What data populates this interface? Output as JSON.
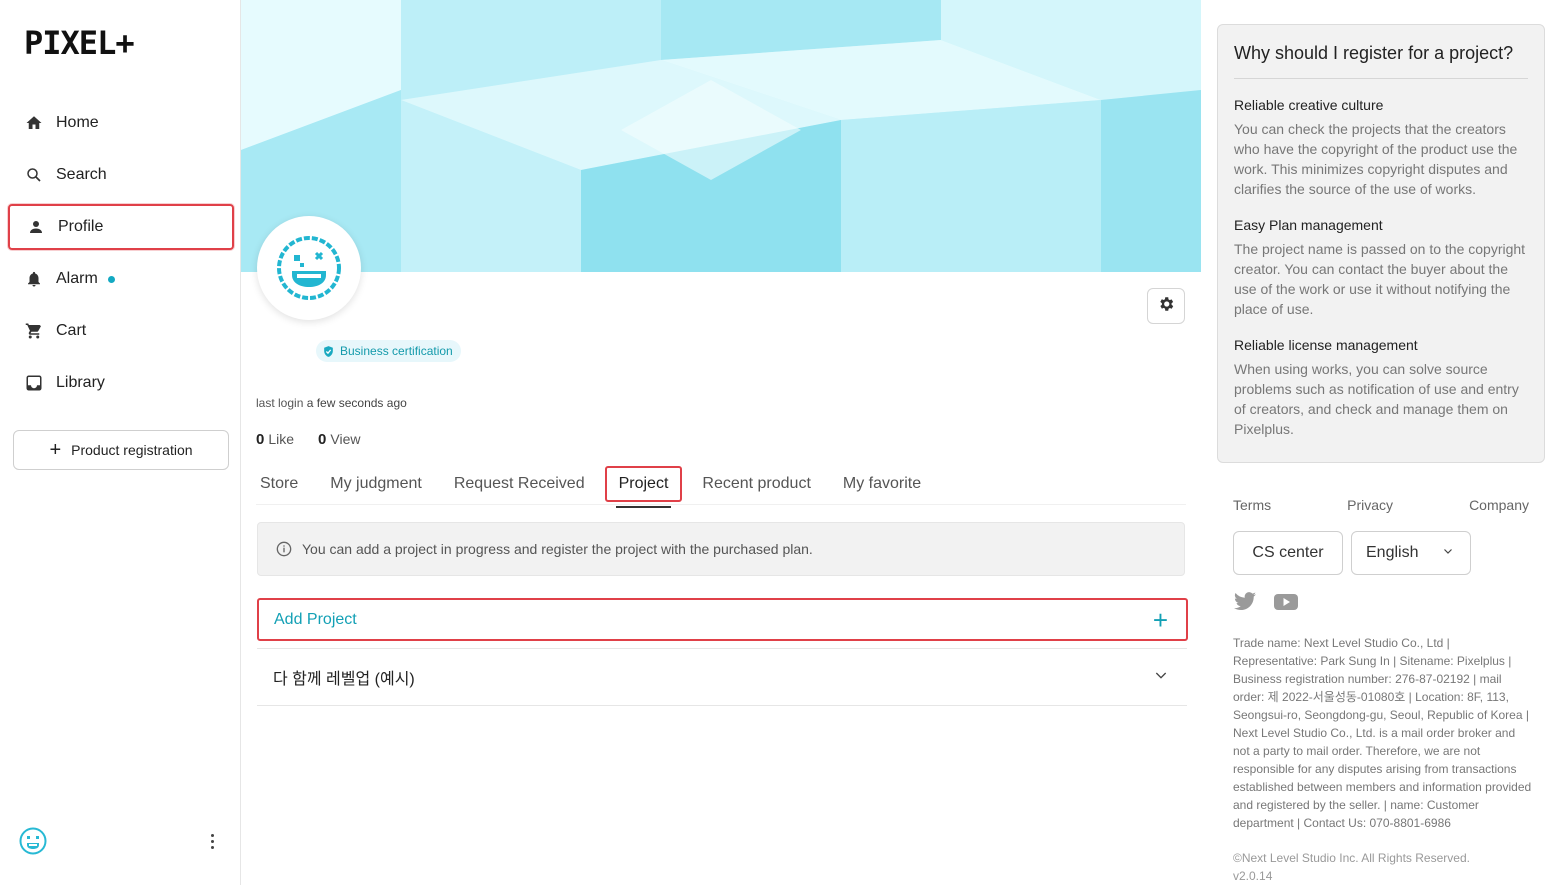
{
  "brand": {
    "logo_text": "PIXEL+"
  },
  "sidebar": {
    "items": [
      {
        "label": "Home",
        "icon": "home-icon"
      },
      {
        "label": "Search",
        "icon": "search-icon"
      },
      {
        "label": "Profile",
        "icon": "person-icon",
        "active": true
      },
      {
        "label": "Alarm",
        "icon": "bell-icon",
        "has_dot": true
      },
      {
        "label": "Cart",
        "icon": "cart-icon"
      },
      {
        "label": "Library",
        "icon": "library-icon"
      }
    ],
    "product_registration_label": "Product registration"
  },
  "profile": {
    "badge_label": "Business certification",
    "last_login_label": "last login",
    "last_login_value": "a few seconds ago",
    "like_count": "0",
    "like_label": "Like",
    "view_count": "0",
    "view_label": "View"
  },
  "tabs": [
    {
      "label": "Store"
    },
    {
      "label": "My judgment"
    },
    {
      "label": "Request Received"
    },
    {
      "label": "Project",
      "active": true
    },
    {
      "label": "Recent product"
    },
    {
      "label": "My favorite"
    }
  ],
  "project": {
    "info_text": "You can add a project in progress and register the project with the purchased plan.",
    "add_label": "Add Project",
    "items": [
      {
        "title": "다 함께 레벨업 (예시)"
      }
    ]
  },
  "why": {
    "title": "Why should I register for a project?",
    "sections": [
      {
        "heading": "Reliable creative culture",
        "body": "You can check the projects that the creators who have the copyright of the product use the work. This minimizes copyright disputes and clarifies the source of the use of works."
      },
      {
        "heading": "Easy Plan management",
        "body": "The project name is passed on to the copyright creator. You can contact the buyer about the use of the work or use it without notifying the place of use."
      },
      {
        "heading": "Reliable license management",
        "body": "When using works, you can solve source problems such as notification of use and entry of creators, and check and manage them on Pixelplus."
      }
    ]
  },
  "footer": {
    "links": [
      "Terms",
      "Privacy",
      "Company"
    ],
    "cs_label": "CS center",
    "language": "English",
    "company_info": "Trade name: Next Level Studio Co., Ltd | Representative: Park Sung In | Sitename: Pixelplus | Business registration number: 276-87-02192 | mail order: 제 2022-서울성동-01080호 | Location: 8F, 113, Seongsui-ro, Seongdong-gu, Seoul, Republic of Korea | Next Level Studio Co., Ltd. is a mail order broker and not a party to mail order. Therefore, we are not responsible for any disputes arising from transactions established between members and information provided and registered by the seller. | name: Customer department | Contact Us: 070-8801-6986",
    "copyright": "©Next Level Studio Inc. All Rights Reserved.",
    "version": "v2.0.14"
  },
  "colors": {
    "accent": "#13a0b5",
    "highlight_border": "#e04048",
    "cover_bg": "#bff0f8"
  }
}
